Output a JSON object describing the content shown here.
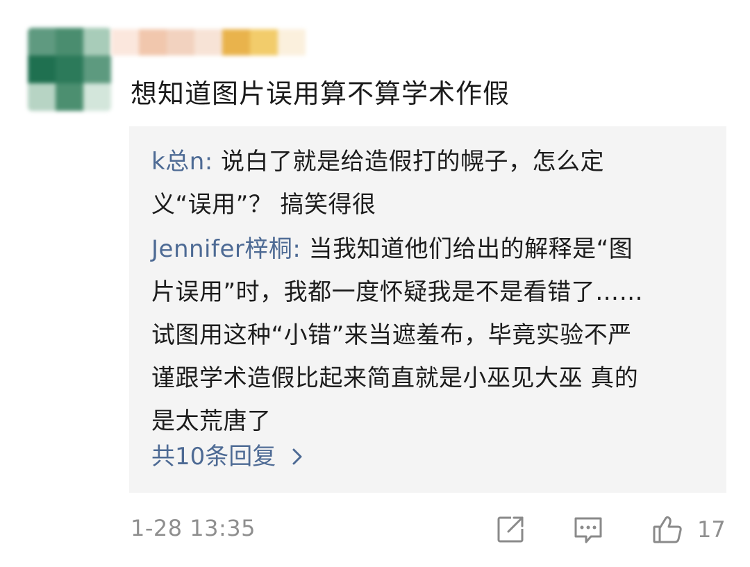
{
  "comment": {
    "text": "想知道图片误用算不算学术作假"
  },
  "replies": [
    {
      "author": "k总n",
      "sep": ": ",
      "lines": [
        "说白了就是给造假打的幌子，怎么定",
        "义“误用”？ 搞笑得很"
      ]
    },
    {
      "author": "Jennifer梓桐",
      "sep": ": ",
      "lines": [
        "当我知道他们给出的解释是“图",
        "片误用”时，我都一度怀疑我是不是看错了……",
        "试图用这种“小错”来当遮羞布，毕竟实验不严",
        "谨跟学术造假比起来简直就是小巫见大巫 真的",
        "是太荒唐了"
      ]
    }
  ],
  "more_replies_label": "共10条回复",
  "footer": {
    "timestamp": "1-28 13:35",
    "like_count": "17"
  },
  "colors": {
    "link": "#4d6a94",
    "reply_bg": "#f4f4f4",
    "muted": "#8f8f8f"
  },
  "icons": {
    "share": "share-icon",
    "comment": "comment-icon",
    "like": "thumbs-up-icon",
    "more": "chevron-right-icon"
  }
}
